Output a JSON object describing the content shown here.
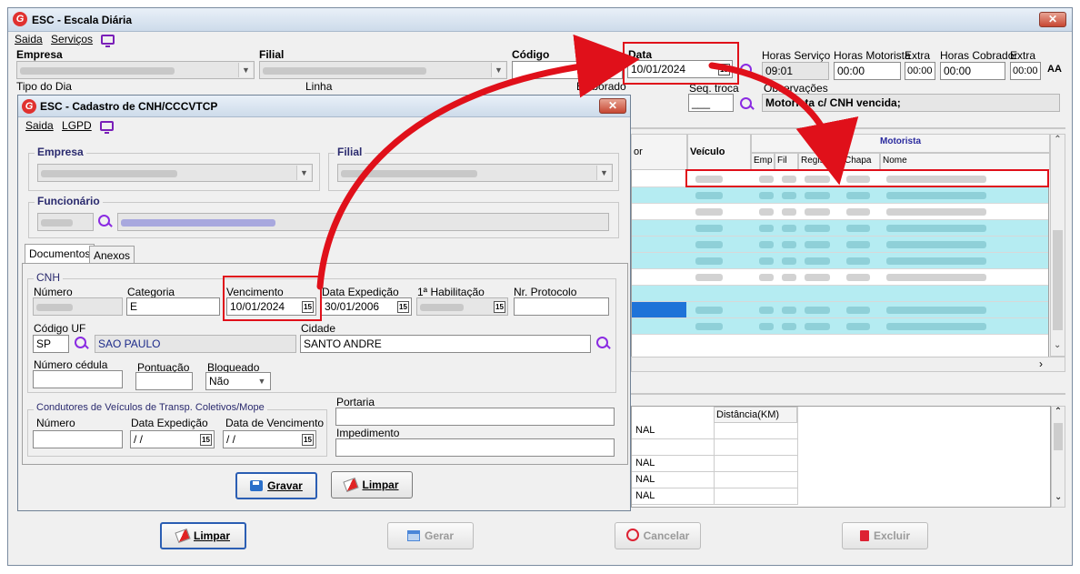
{
  "main": {
    "title": "ESC - Escala Diária",
    "menu": [
      "Saida",
      "Serviços"
    ],
    "labels": {
      "empresa": "Empresa",
      "filial": "Filial",
      "codigo": "Código",
      "data": "Data",
      "horas_servico": "Horas Serviço",
      "horas_motorista": "Horas Motorista",
      "extra1": "Extra",
      "horas_cobrador": "Horas Cobrador",
      "extra2": "Extra",
      "tipo_dia": "Tipo do Dia",
      "linha": "Linha",
      "elaborado": "Elaborado",
      "seq_troca": "Seq. troca",
      "observacoes": "Observações"
    },
    "values": {
      "data": "10/01/2024",
      "horas_servico": "09:01",
      "horas_motorista": "00:00",
      "extra1": "00:00",
      "horas_cobrador": "00:00",
      "extra2": "00:00",
      "seq_troca": "___",
      "observacoes": "Motorista c/ CNH vencida;"
    },
    "grid": {
      "col_partial": "or",
      "col_veiculo": "Veículo",
      "group_motorista": "Motorista",
      "col_emp": "Emp",
      "col_fil": "Fil",
      "col_registro": "Registro",
      "col_chapa": "Chapa",
      "col_nome": "Nome"
    },
    "lower_grid": {
      "col_distancia": "Distância(KM)",
      "rows": [
        "NAL",
        "NAL",
        "NAL",
        "NAL"
      ]
    },
    "buttons": {
      "limpar": "Limpar",
      "gerar": "Gerar",
      "cancelar": "Cancelar",
      "excluir": "Excluir"
    },
    "aa_icon": "AA"
  },
  "dialog": {
    "title": "ESC - Cadastro de CNH/CCCVTCP",
    "menu": [
      "Saida",
      "LGPD"
    ],
    "group_empresa": "Empresa",
    "group_filial": "Filial",
    "group_funcionario": "Funcionário",
    "tabs": [
      "Documentos",
      "Anexos"
    ],
    "cnh": {
      "title": "CNH",
      "numero_label": "Número",
      "categoria_label": "Categoria",
      "categoria_value": "E",
      "vencimento_label": "Vencimento",
      "vencimento_value": "10/01/2024",
      "data_expedicao_label": "Data Expedição",
      "data_expedicao_value": "30/01/2006",
      "primeira_habilitacao_label": "1ª Habilitação",
      "nr_protocolo_label": "Nr. Protocolo",
      "codigo_uf_label": "Código UF",
      "codigo_uf_value": "SP",
      "uf_nome": "SAO PAULO",
      "cidade_label": "Cidade",
      "cidade_value": "SANTO ANDRE",
      "numero_cedula_label": "Número cédula",
      "pontuacao_label": "Pontuação",
      "bloqueado_label": "Bloqueado",
      "bloqueado_value": "Não"
    },
    "condutores": {
      "title": "Condutores de Veículos de Transp. Coletivos/Mope",
      "numero_label": "Número",
      "data_expedicao_label": "Data Expedição",
      "data_expedicao_value": " / /",
      "data_vencimento_label": "Data de Vencimento",
      "data_vencimento_value": " / /"
    },
    "portaria_label": "Portaria",
    "impedimento_label": "Impedimento",
    "buttons": {
      "gravar": "Gravar",
      "limpar": "Limpar"
    }
  },
  "colors": {
    "highlight_red": "#e0101a",
    "row_cyan": "#b5ecf2",
    "selected_row": "#1e73d8",
    "group_title": "#2a2a6e",
    "search_icon": "#8a2be2"
  }
}
